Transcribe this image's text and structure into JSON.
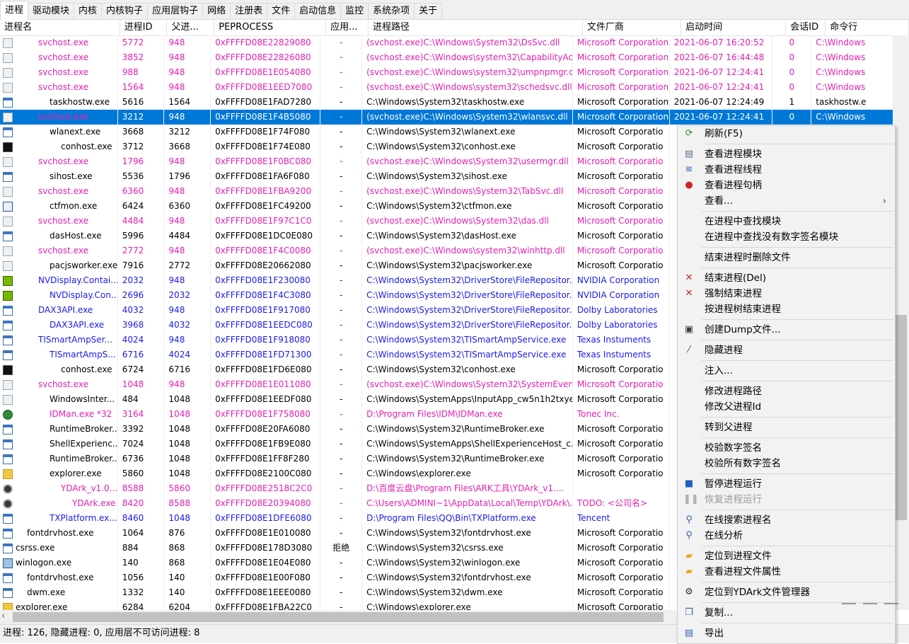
{
  "tabs": [
    "进程",
    "驱动模块",
    "内核",
    "内核钩子",
    "应用层钩子",
    "网络",
    "注册表",
    "文件",
    "启动信息",
    "监控",
    "系统杂项",
    "关于"
  ],
  "columns": [
    "进程名",
    "进程ID",
    "父进...",
    "PEPROCESS",
    "应用...",
    "进程路径",
    "文件厂商",
    "启动时间",
    "会话ID",
    "命令行"
  ],
  "colors": {
    "pink": "#e61eb4",
    "blue": "#1a1aee",
    "black": "#000000",
    "selected": "#0078d7"
  },
  "rows": [
    {
      "name": "svchost.exe",
      "pid": "5772",
      "ppid": "948",
      "ep": "0xFFFFD08E22829080",
      "app": "-",
      "path": "(svchost.exe)C:\\Windows\\System32\\DsSvc.dll",
      "vendor": "Microsoft Corporation",
      "time": "2021-06-07 16:20:52",
      "sid": "0",
      "cmd": "C:\\Windows",
      "color": "pink",
      "indent": 2,
      "icon": "file"
    },
    {
      "name": "svchost.exe",
      "pid": "3852",
      "ppid": "948",
      "ep": "0xFFFFD08E22826080",
      "app": "-",
      "path": "(svchost.exe)C:\\Windows\\system32\\CapabilityAcc...",
      "vendor": "Microsoft Corporation",
      "time": "2021-06-07 16:44:48",
      "sid": "0",
      "cmd": "C:\\Windows",
      "color": "pink",
      "indent": 2,
      "icon": "file"
    },
    {
      "name": "svchost.exe",
      "pid": "988",
      "ppid": "948",
      "ep": "0xFFFFD08E1E054080",
      "app": "-",
      "path": "(svchost.exe)C:\\Windows\\system32\\umpnpmgr.dll",
      "vendor": "Microsoft Corporation",
      "time": "2021-06-07 12:24:41",
      "sid": "0",
      "cmd": "C:\\Windows",
      "color": "pink",
      "indent": 2,
      "icon": "file"
    },
    {
      "name": "svchost.exe",
      "pid": "1564",
      "ppid": "948",
      "ep": "0xFFFFD08E1EED7080",
      "app": "-",
      "path": "(svchost.exe)C:\\Windows\\system32\\schedsvc.dll",
      "vendor": "Microsoft Corporation",
      "time": "2021-06-07 12:24:41",
      "sid": "0",
      "cmd": "C:\\Windows",
      "color": "pink",
      "indent": 2,
      "icon": "file"
    },
    {
      "name": "taskhostw.exe",
      "pid": "5616",
      "ppid": "1564",
      "ep": "0xFFFFD08E1FAD7280",
      "app": "-",
      "path": "C:\\Windows\\System32\\taskhostw.exe",
      "vendor": "Microsoft Corporation",
      "time": "2021-06-07 12:24:49",
      "sid": "1",
      "cmd": "taskhostw.e",
      "color": "black",
      "indent": 3,
      "icon": "app"
    },
    {
      "name": "svchost.exe",
      "pid": "3212",
      "ppid": "948",
      "ep": "0xFFFFD08E1F4B5080",
      "app": "-",
      "path": "(svchost.exe)C:\\Windows\\System32\\wlansvc.dll",
      "vendor": "Microsoft Corporation",
      "time": "2021-06-07 12:24:41",
      "sid": "0",
      "cmd": "C:\\Windows",
      "color": "pink",
      "indent": 2,
      "icon": "file",
      "selected": true
    },
    {
      "name": "wlanext.exe",
      "pid": "3668",
      "ppid": "3212",
      "ep": "0xFFFFD08E1F74F080",
      "app": "-",
      "path": "C:\\Windows\\System32\\wlanext.exe",
      "vendor": "Microsoft Corporatio",
      "time": "",
      "sid": "",
      "cmd": "",
      "color": "black",
      "indent": 3,
      "icon": "app"
    },
    {
      "name": "conhost.exe",
      "pid": "3712",
      "ppid": "3668",
      "ep": "0xFFFFD08E1F74E080",
      "app": "-",
      "path": "C:\\Windows\\System32\\conhost.exe",
      "vendor": "Microsoft Corporatio",
      "time": "",
      "sid": "",
      "cmd": "",
      "color": "black",
      "indent": 4,
      "icon": "cmd"
    },
    {
      "name": "svchost.exe",
      "pid": "1796",
      "ppid": "948",
      "ep": "0xFFFFD08E1F0BC080",
      "app": "-",
      "path": "(svchost.exe)C:\\Windows\\System32\\usermgr.dll",
      "vendor": "Microsoft Corporatio",
      "time": "",
      "sid": "",
      "cmd": "",
      "color": "pink",
      "indent": 2,
      "icon": "file"
    },
    {
      "name": "sihost.exe",
      "pid": "5536",
      "ppid": "1796",
      "ep": "0xFFFFD08E1FA6F080",
      "app": "-",
      "path": "C:\\Windows\\System32\\sihost.exe",
      "vendor": "Microsoft Corporatio",
      "time": "",
      "sid": "",
      "cmd": "",
      "color": "black",
      "indent": 3,
      "icon": "app"
    },
    {
      "name": "svchost.exe",
      "pid": "6360",
      "ppid": "948",
      "ep": "0xFFFFD08E1FBA9200",
      "app": "-",
      "path": "(svchost.exe)C:\\Windows\\System32\\TabSvc.dll",
      "vendor": "Microsoft Corporatio",
      "time": "",
      "sid": "",
      "cmd": "",
      "color": "pink",
      "indent": 2,
      "icon": "file"
    },
    {
      "name": "ctfmon.exe",
      "pid": "6424",
      "ppid": "6360",
      "ep": "0xFFFFD08E1FC49200",
      "app": "-",
      "path": "C:\\Windows\\System32\\ctfmon.exe",
      "vendor": "Microsoft Corporatio",
      "time": "",
      "sid": "",
      "cmd": "",
      "color": "black",
      "indent": 3,
      "icon": "pen"
    },
    {
      "name": "svchost.exe",
      "pid": "4484",
      "ppid": "948",
      "ep": "0xFFFFD08E1F97C1C0",
      "app": "-",
      "path": "(svchost.exe)C:\\Windows\\System32\\das.dll",
      "vendor": "Microsoft Corporatio",
      "time": "",
      "sid": "",
      "cmd": "",
      "color": "pink",
      "indent": 2,
      "icon": "file"
    },
    {
      "name": "dasHost.exe",
      "pid": "5996",
      "ppid": "4484",
      "ep": "0xFFFFD08E1DC0E080",
      "app": "-",
      "path": "C:\\Windows\\System32\\dasHost.exe",
      "vendor": "Microsoft Corporatio",
      "time": "",
      "sid": "",
      "cmd": "",
      "color": "black",
      "indent": 3,
      "icon": "app"
    },
    {
      "name": "svchost.exe",
      "pid": "2772",
      "ppid": "948",
      "ep": "0xFFFFD08E1F4C0080",
      "app": "-",
      "path": "(svchost.exe)C:\\Windows\\system32\\winhttp.dll",
      "vendor": "Microsoft Corporatio",
      "time": "",
      "sid": "",
      "cmd": "",
      "color": "pink",
      "indent": 2,
      "icon": "file"
    },
    {
      "name": "pacjsworker.exe",
      "pid": "7916",
      "ppid": "2772",
      "ep": "0xFFFFD08E20662080",
      "app": "-",
      "path": "C:\\Windows\\System32\\pacjsworker.exe",
      "vendor": "Microsoft Corporatio",
      "time": "",
      "sid": "",
      "cmd": "",
      "color": "black",
      "indent": 3,
      "icon": "file"
    },
    {
      "name": "NVDisplay.Contai...",
      "pid": "2032",
      "ppid": "948",
      "ep": "0xFFFFD08E1F230080",
      "app": "-",
      "path": "C:\\Windows\\System32\\DriverStore\\FileRepositor...",
      "vendor": "NVIDIA Corporation",
      "time": "",
      "sid": "",
      "cmd": "",
      "color": "blue",
      "indent": 2,
      "icon": "nv"
    },
    {
      "name": "NVDisplay.Con...",
      "pid": "2696",
      "ppid": "2032",
      "ep": "0xFFFFD08E1F4C3080",
      "app": "-",
      "path": "C:\\Windows\\System32\\DriverStore\\FileRepositor...",
      "vendor": "NVIDIA Corporation",
      "time": "",
      "sid": "",
      "cmd": "",
      "color": "blue",
      "indent": 3,
      "icon": "nv"
    },
    {
      "name": "DAX3API.exe",
      "pid": "4032",
      "ppid": "948",
      "ep": "0xFFFFD08E1F917080",
      "app": "-",
      "path": "C:\\Windows\\System32\\DriverStore\\FileRepositor...",
      "vendor": "Dolby Laboratories",
      "time": "",
      "sid": "",
      "cmd": "",
      "color": "blue",
      "indent": 2,
      "icon": "app"
    },
    {
      "name": "DAX3API.exe",
      "pid": "3968",
      "ppid": "4032",
      "ep": "0xFFFFD08E1EEDC080",
      "app": "-",
      "path": "C:\\Windows\\System32\\DriverStore\\FileRepositor...",
      "vendor": "Dolby Laboratories",
      "time": "",
      "sid": "",
      "cmd": "",
      "color": "blue",
      "indent": 3,
      "icon": "app"
    },
    {
      "name": "TISmartAmpSer...",
      "pid": "4024",
      "ppid": "948",
      "ep": "0xFFFFD08E1F918080",
      "app": "-",
      "path": "C:\\Windows\\System32\\TISmartAmpService.exe",
      "vendor": "Texas Instuments",
      "time": "",
      "sid": "",
      "cmd": "",
      "color": "blue",
      "indent": 2,
      "icon": "app"
    },
    {
      "name": "TISmartAmpS...",
      "pid": "6716",
      "ppid": "4024",
      "ep": "0xFFFFD08E1FD71300",
      "app": "-",
      "path": "C:\\Windows\\System32\\TISmartAmpService.exe",
      "vendor": "Texas Instuments",
      "time": "",
      "sid": "",
      "cmd": "",
      "color": "blue",
      "indent": 3,
      "icon": "app"
    },
    {
      "name": "conhost.exe",
      "pid": "6724",
      "ppid": "6716",
      "ep": "0xFFFFD08E1FD6E080",
      "app": "-",
      "path": "C:\\Windows\\System32\\conhost.exe",
      "vendor": "Microsoft Corporatio",
      "time": "",
      "sid": "",
      "cmd": "",
      "color": "black",
      "indent": 4,
      "icon": "cmd"
    },
    {
      "name": "svchost.exe",
      "pid": "1048",
      "ppid": "948",
      "ep": "0xFFFFD08E1E011080",
      "app": "-",
      "path": "(svchost.exe)C:\\Windows\\System32\\SystemEvent...",
      "vendor": "Microsoft Corporatio",
      "time": "",
      "sid": "",
      "cmd": "",
      "color": "pink",
      "indent": 2,
      "icon": "file"
    },
    {
      "name": "WindowsInter...",
      "pid": "484",
      "ppid": "1048",
      "ep": "0xFFFFD08E1EEDF080",
      "app": "-",
      "path": "C:\\Windows\\SystemApps\\InputApp_cw5n1h2txye...",
      "vendor": "Microsoft Corporatio",
      "time": "",
      "sid": "",
      "cmd": "",
      "color": "black",
      "indent": 3,
      "icon": "file"
    },
    {
      "name": "IDMan.exe *32",
      "pid": "3164",
      "ppid": "1048",
      "ep": "0xFFFFD08E1F758080",
      "app": "-",
      "path": "D:\\Program Files\\IDM\\IDMan.exe",
      "vendor": "Tonec Inc.",
      "time": "",
      "sid": "",
      "cmd": "",
      "color": "pink",
      "indent": 3,
      "icon": "idm"
    },
    {
      "name": "RuntimeBroker...",
      "pid": "3392",
      "ppid": "1048",
      "ep": "0xFFFFD08E20FA6080",
      "app": "-",
      "path": "C:\\Windows\\System32\\RuntimeBroker.exe",
      "vendor": "Microsoft Corporatio",
      "time": "",
      "sid": "",
      "cmd": "",
      "color": "black",
      "indent": 3,
      "icon": "app"
    },
    {
      "name": "ShellExperienc...",
      "pid": "7024",
      "ppid": "1048",
      "ep": "0xFFFFD08E1FB9E080",
      "app": "-",
      "path": "C:\\Windows\\SystemApps\\ShellExperienceHost_c...",
      "vendor": "Microsoft Corporatio",
      "time": "",
      "sid": "",
      "cmd": "",
      "color": "black",
      "indent": 3,
      "icon": "app"
    },
    {
      "name": "RuntimeBroker...",
      "pid": "6736",
      "ppid": "1048",
      "ep": "0xFFFFD08E1FF8F280",
      "app": "-",
      "path": "C:\\Windows\\System32\\RuntimeBroker.exe",
      "vendor": "Microsoft Corporatio",
      "time": "",
      "sid": "",
      "cmd": "",
      "color": "black",
      "indent": 3,
      "icon": "app"
    },
    {
      "name": "explorer.exe",
      "pid": "5860",
      "ppid": "1048",
      "ep": "0xFFFFD08E2100C080",
      "app": "-",
      "path": "C:\\Windows\\explorer.exe",
      "vendor": "Microsoft Corporatio",
      "time": "",
      "sid": "",
      "cmd": "",
      "color": "black",
      "indent": 3,
      "icon": "folder"
    },
    {
      "name": "YDArk_v1.0....",
      "pid": "8588",
      "ppid": "5860",
      "ep": "0xFFFFD08E2518C2C0",
      "app": "-",
      "path": "D:\\百度云盘\\Program Files\\ARK工具\\YDArk_v1....",
      "vendor": "",
      "time": "",
      "sid": "",
      "cmd": "",
      "color": "pink",
      "indent": 4,
      "icon": "gear"
    },
    {
      "name": "YDArk.exe",
      "pid": "8420",
      "ppid": "8588",
      "ep": "0xFFFFD08E20394080",
      "app": "-",
      "path": "C:\\Users\\ADMINI~1\\AppData\\Local\\Temp\\YDArk\\...",
      "vendor": "TODO: <公司名>",
      "time": "",
      "sid": "",
      "cmd": "",
      "color": "pink",
      "indent": 5,
      "icon": "gear"
    },
    {
      "name": "TXPlatform.ex...",
      "pid": "8460",
      "ppid": "1048",
      "ep": "0xFFFFD08E1DFE6080",
      "app": "-",
      "path": "D:\\Program Files\\QQ\\Bin\\TXPlatform.exe",
      "vendor": "Tencent",
      "time": "",
      "sid": "",
      "cmd": "",
      "color": "blue",
      "indent": 3,
      "icon": "app"
    },
    {
      "name": "fontdrvhost.exe",
      "pid": "1064",
      "ppid": "876",
      "ep": "0xFFFFD08E1E010080",
      "app": "-",
      "path": "C:\\Windows\\System32\\fontdrvhost.exe",
      "vendor": "Microsoft Corporatio",
      "time": "",
      "sid": "",
      "cmd": "",
      "color": "black",
      "indent": 1,
      "icon": "app"
    },
    {
      "name": "csrss.exe",
      "pid": "884",
      "ppid": "868",
      "ep": "0xFFFFD08E178D3080",
      "app": "拒绝",
      "path": "C:\\Windows\\System32\\csrss.exe",
      "vendor": "Microsoft Corporatio",
      "time": "",
      "sid": "",
      "cmd": "",
      "color": "black",
      "indent": 0,
      "icon": "app"
    },
    {
      "name": "winlogon.exe",
      "pid": "140",
      "ppid": "868",
      "ep": "0xFFFFD08E1E04E080",
      "app": "-",
      "path": "C:\\Windows\\System32\\winlogon.exe",
      "vendor": "Microsoft Corporatio",
      "time": "",
      "sid": "",
      "cmd": "",
      "color": "black",
      "indent": 0,
      "icon": "wl"
    },
    {
      "name": "fontdrvhost.exe",
      "pid": "1056",
      "ppid": "140",
      "ep": "0xFFFFD08E1E00F080",
      "app": "-",
      "path": "C:\\Windows\\System32\\fontdrvhost.exe",
      "vendor": "Microsoft Corporatio",
      "time": "",
      "sid": "",
      "cmd": "",
      "color": "black",
      "indent": 1,
      "icon": "app"
    },
    {
      "name": "dwm.exe",
      "pid": "1332",
      "ppid": "140",
      "ep": "0xFFFFD08E1EEE0080",
      "app": "-",
      "path": "C:\\Windows\\System32\\dwm.exe",
      "vendor": "Microsoft Corporatio",
      "time": "",
      "sid": "",
      "cmd": "",
      "color": "black",
      "indent": 1,
      "icon": "app"
    },
    {
      "name": "explorer.exe",
      "pid": "6284",
      "ppid": "6204",
      "ep": "0xFFFFD08E1FBA22C0",
      "app": "-",
      "path": "C:\\Windows\\explorer.exe",
      "vendor": "Microsoft Corporatio",
      "time": "",
      "sid": "",
      "cmd": "",
      "color": "black",
      "indent": 0,
      "icon": "folder"
    }
  ],
  "menu": [
    {
      "label": "刷新(F5)",
      "icon": "refresh-icon",
      "glyph": "⟳",
      "gcolor": "#2e8b2e"
    },
    {
      "sep": true
    },
    {
      "label": "查看进程模块",
      "icon": "modules-icon",
      "glyph": "▤",
      "gcolor": "#5a6f8c"
    },
    {
      "label": "查看进程线程",
      "icon": "threads-icon",
      "glyph": "≋",
      "gcolor": "#2d5fb0"
    },
    {
      "label": "查看进程句柄",
      "icon": "handles-icon",
      "glyph": "●",
      "gcolor": "#c8242b"
    },
    {
      "label": "查看...",
      "icon": "",
      "glyph": "",
      "gcolor": "",
      "arrow": "›"
    },
    {
      "sep": true
    },
    {
      "label": "在进程中查找模块",
      "icon": "",
      "glyph": "",
      "gcolor": ""
    },
    {
      "label": "在进程中查找没有数字签名模块",
      "icon": "",
      "glyph": "",
      "gcolor": ""
    },
    {
      "sep": true
    },
    {
      "label": "结束进程时删除文件",
      "icon": "",
      "glyph": "",
      "gcolor": ""
    },
    {
      "sep": true
    },
    {
      "label": "结束进程(Del)",
      "icon": "close-icon",
      "glyph": "✕",
      "gcolor": "#c8242b"
    },
    {
      "label": "强制结束进程",
      "icon": "close-icon",
      "glyph": "✕",
      "gcolor": "#c8242b"
    },
    {
      "label": "按进程树结束进程",
      "icon": "",
      "glyph": "",
      "gcolor": ""
    },
    {
      "sep": true
    },
    {
      "label": "创建Dump文件...",
      "icon": "monitor-icon",
      "glyph": "▣",
      "gcolor": "#3c3c3c"
    },
    {
      "sep": true
    },
    {
      "label": "隐藏进程",
      "icon": "syringe-icon",
      "glyph": "⁄",
      "gcolor": "#555555"
    },
    {
      "sep": true
    },
    {
      "label": "注入...",
      "icon": "",
      "glyph": "",
      "gcolor": ""
    },
    {
      "sep": true
    },
    {
      "label": "修改进程路径",
      "icon": "",
      "glyph": "",
      "gcolor": ""
    },
    {
      "label": "修改父进程Id",
      "icon": "",
      "glyph": "",
      "gcolor": ""
    },
    {
      "sep": true
    },
    {
      "label": "转到父进程",
      "icon": "",
      "glyph": "",
      "gcolor": ""
    },
    {
      "sep": true
    },
    {
      "label": "校验数字签名",
      "icon": "",
      "glyph": "",
      "gcolor": ""
    },
    {
      "label": "校验所有数字签名",
      "icon": "",
      "glyph": "",
      "gcolor": ""
    },
    {
      "sep": true
    },
    {
      "label": "暂停进程运行",
      "icon": "stop-icon",
      "glyph": "■",
      "gcolor": "#1f5fbf"
    },
    {
      "label": "恢复进程运行",
      "icon": "pause-icon",
      "glyph": "❚❚",
      "gcolor": "#b0b0b0",
      "disabled": true
    },
    {
      "sep": true
    },
    {
      "label": "在线搜索进程名",
      "icon": "search-icon",
      "glyph": "⚲",
      "gcolor": "#2d5fb0"
    },
    {
      "label": "在线分析",
      "icon": "search-icon",
      "glyph": "⚲",
      "gcolor": "#2d5fb0"
    },
    {
      "sep": true
    },
    {
      "label": "定位到进程文件",
      "icon": "folder-icon",
      "glyph": "▰",
      "gcolor": "#e3a91f"
    },
    {
      "label": "查看进程文件属性",
      "icon": "folder-icon",
      "glyph": "▰",
      "gcolor": "#e3a91f"
    },
    {
      "sep": true
    },
    {
      "label": "定位到YDArk文件管理器",
      "icon": "gear-icon",
      "glyph": "⚙",
      "gcolor": "#333333"
    },
    {
      "sep": true
    },
    {
      "label": "复制...",
      "icon": "copy-icon",
      "glyph": "❐",
      "gcolor": "#2d5fb0"
    },
    {
      "sep": true
    },
    {
      "label": "导出",
      "icon": "export-icon",
      "glyph": "▤",
      "gcolor": "#2d5fb0"
    }
  ],
  "status": "进程:  126, 隐藏进程:  0, 应用层不可访问进程:  8"
}
